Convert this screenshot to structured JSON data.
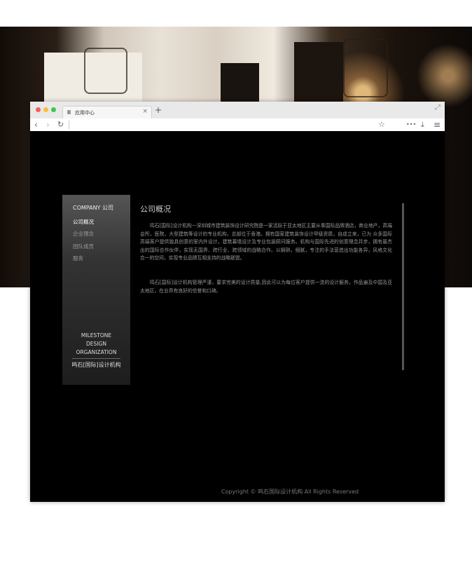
{
  "browser": {
    "tab_title": "应用中心",
    "tab_close": "×",
    "new_tab": "+",
    "expand_icon": "⤢",
    "nav": {
      "back": "‹",
      "forward": "›",
      "reload": "↻",
      "star": "☆",
      "more": "•••",
      "download": "⤓",
      "menu": "≡"
    }
  },
  "sidebar": {
    "heading": "COMPANY 公司",
    "items": [
      {
        "label": "公司概况",
        "active": true
      },
      {
        "label": "企业理念",
        "active": false
      },
      {
        "label": "团队成员",
        "active": false
      },
      {
        "label": "服务",
        "active": false
      }
    ],
    "logo_lines": [
      "MILESTONE",
      "DESIGN",
      "ORGANIZATION"
    ],
    "logo_cn": "鸣石[国际]设计机构"
  },
  "main": {
    "title": "公司概况",
    "paragraphs": [
      "鸣石[国际]设计机构—深圳城市建筑装饰设计研究院是一家活跃于亚太地区主要从事国际品牌酒店，商业地产，高端会所，医院，大型建筑等设计的专业机构，总部位于香港。拥有国家建筑装饰设计甲级资质，自成立来，已为 众多国际高端客户提供独具创意的室内外设计，建筑幕墙设计及专业包装顾问服务。机构与国际先进的创意理念并步，拥有最杰出的国际合作伙伴，实现无国界、跨行业、跨领域的战略合作。以娴熟，细腻，专注的手法营造出功能各异，风格文化合一的空间，实现专业品牌互相支持的战略联盟。",
      "鸣石[国际]设计机构管理严谨，要求完美的设计质量,因此可以为每位客户提供一流的设计服务。作品遍及中国及亚太地区，在业界有良好的信誉和口碑。"
    ]
  },
  "footer": {
    "copyright": "Copyright © 鸣石国际设计机构 All Rights Reserved"
  },
  "colors": {
    "page_bg": "#000000",
    "sidebar_top": "#555555",
    "accent_text": "#ffffff"
  }
}
